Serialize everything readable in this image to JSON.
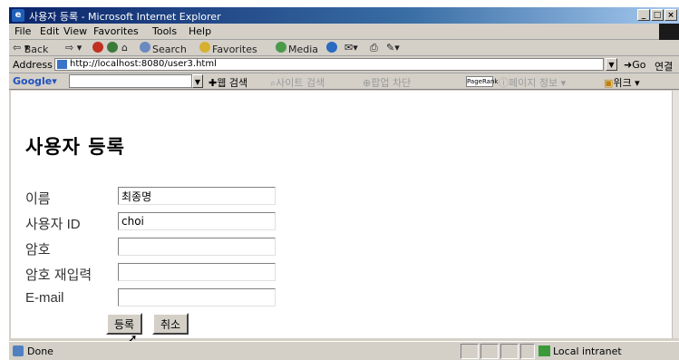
{
  "window": {
    "title": "사용자 등록 - Microsoft Internet Explorer"
  },
  "menu": [
    "File",
    "Edit",
    "View",
    "Favorites",
    "Tools",
    "Help"
  ],
  "toolbar": {
    "back": "Back",
    "search": "Search",
    "favorites": "Favorites",
    "media": "Media"
  },
  "address": {
    "label": "Address",
    "url": "http://localhost:8080/user3.html",
    "go": "Go",
    "links": "연결"
  },
  "google_bar": {
    "logo": "Google",
    "search_web": "웹 검색",
    "site_search": "사이트 검색",
    "popup_blocker": "팝업 차단",
    "pagerank": "PageRank",
    "page_info": "페이지 정보",
    "bookmark": "위크"
  },
  "page": {
    "heading": "사용자 등록",
    "fields": [
      {
        "label": "이름",
        "value": "최종명"
      },
      {
        "label": "사용자 ID",
        "value": "choi"
      },
      {
        "label": "암호",
        "value": ""
      },
      {
        "label": "암호 재입력",
        "value": ""
      },
      {
        "label": "E-mail",
        "value": ""
      }
    ],
    "submit_label": "등록",
    "cancel_label": "취소"
  },
  "status": {
    "text": "Done",
    "zone": "Local intranet"
  },
  "colors": {
    "titlebar": "#0a246a",
    "chrome": "#d4d0c8"
  }
}
